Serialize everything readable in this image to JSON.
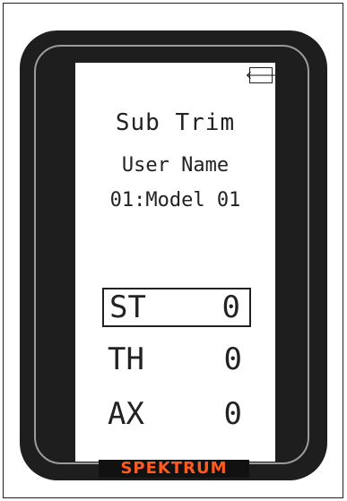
{
  "screen": {
    "back_icon_glyph": "🡐",
    "title": "Sub Trim",
    "user_name_label": "User Name",
    "model_label": "01:Model 01",
    "channels": [
      {
        "label": "ST",
        "value": "0",
        "selected": true
      },
      {
        "label": "TH",
        "value": "0",
        "selected": false
      },
      {
        "label": "AX",
        "value": "0",
        "selected": false
      }
    ]
  },
  "brand": {
    "logo_text": "SPEKTRUM",
    "logo_color": "#ff5a1f"
  },
  "colors": {
    "bezel": "#1e1e1e",
    "screen": "#ffffff",
    "text": "#222222"
  }
}
